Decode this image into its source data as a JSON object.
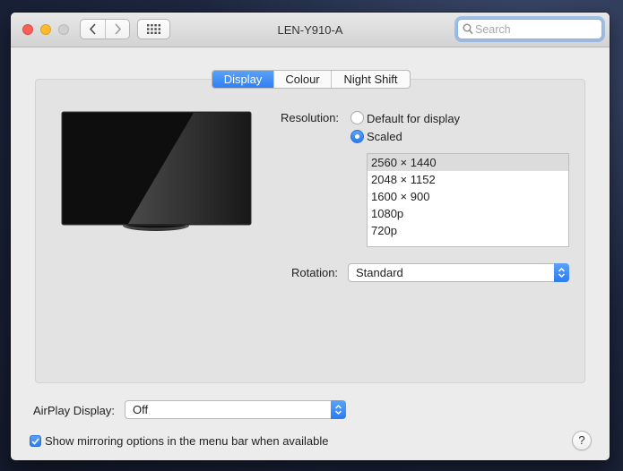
{
  "window": {
    "title": "LEN-Y910-A"
  },
  "toolbar": {
    "back_icon": "chevron-left-icon",
    "forward_icon": "chevron-right-icon",
    "show_all_icon": "grid-icon",
    "search_placeholder": "Search",
    "search_value": ""
  },
  "tabs": [
    {
      "label": "Display",
      "selected": true
    },
    {
      "label": "Colour",
      "selected": false
    },
    {
      "label": "Night Shift",
      "selected": false
    }
  ],
  "display": {
    "resolution_label": "Resolution:",
    "options": [
      {
        "label": "Default for display",
        "selected": false
      },
      {
        "label": "Scaled",
        "selected": true
      }
    ],
    "resolutions": [
      "2560 × 1440",
      "2048 × 1152",
      "1600 × 900",
      "1080p",
      "720p"
    ],
    "selected_resolution": "2560 × 1440",
    "rotation_label": "Rotation:",
    "rotation_value": "Standard"
  },
  "airplay": {
    "label": "AirPlay Display:",
    "value": "Off"
  },
  "mirroring": {
    "label": "Show mirroring options in the menu bar when available",
    "checked": true
  },
  "help": {
    "label": "?"
  },
  "colors": {
    "accent": "#2f7ff2"
  }
}
